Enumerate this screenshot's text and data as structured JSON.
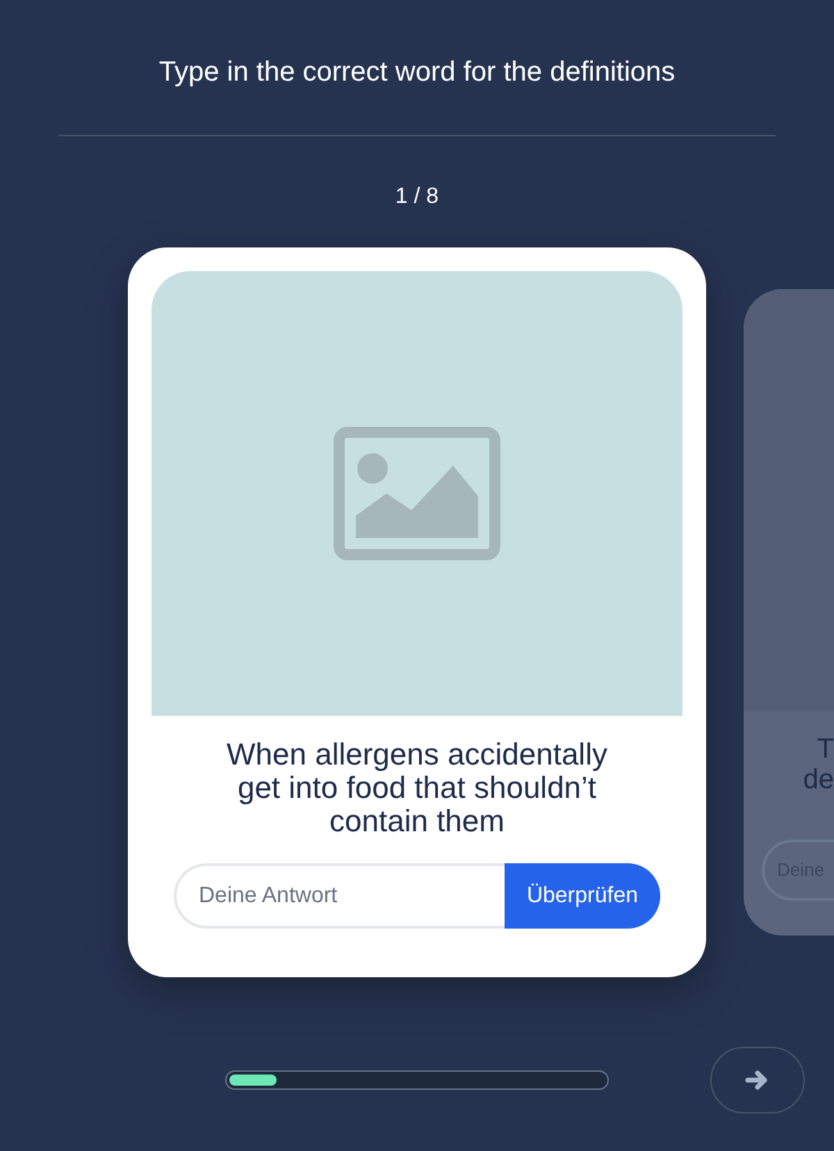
{
  "instruction": "Type in the correct word for the definitions",
  "counter": "1 / 8",
  "cards": [
    {
      "kind": "current",
      "image": {
        "kind": "placeholder"
      },
      "definition_lines": [
        "When allergens accidentally",
        "get into food that shouldn’t",
        "contain them"
      ],
      "answer": {
        "placeholder": "Deine Antwort"
      },
      "check_button": "Überprüfen"
    },
    {
      "kind": "next",
      "definition_lines": [
        "T",
        "de"
      ],
      "answer": {
        "placeholder": "Deine"
      }
    }
  ],
  "progress": {
    "level": 0.125
  }
}
